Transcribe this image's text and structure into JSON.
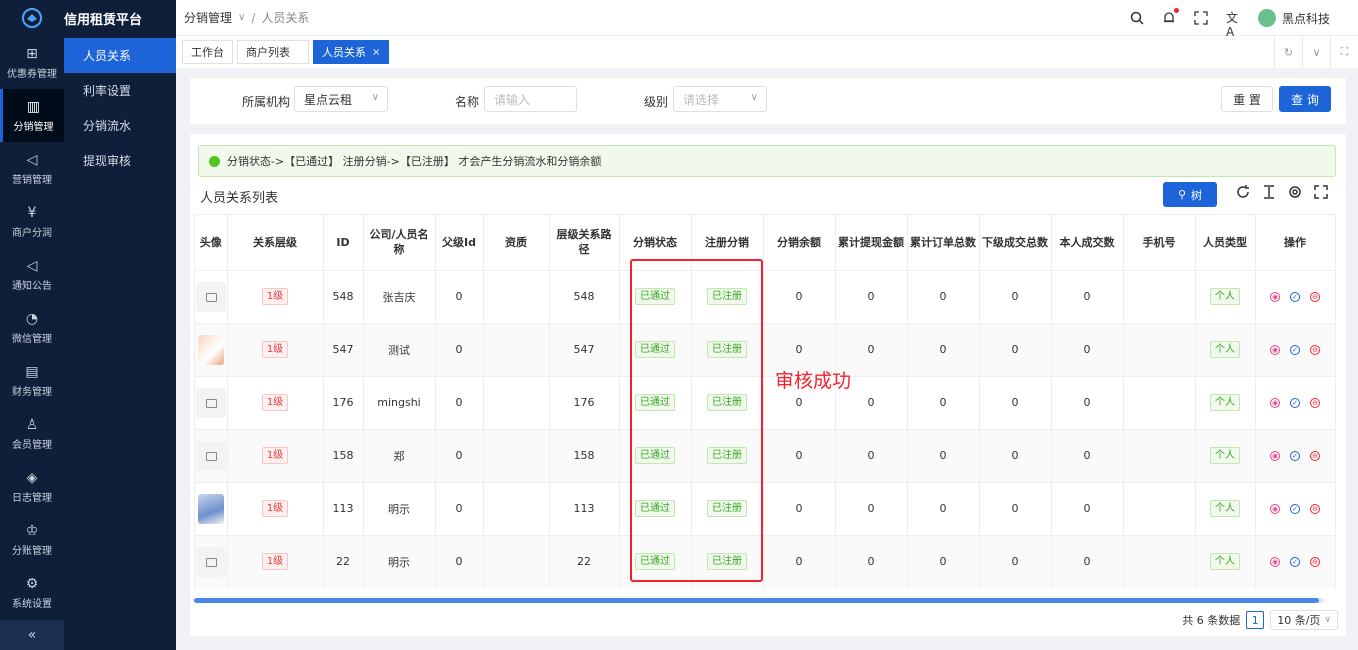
{
  "app": {
    "title": "信用租赁平台"
  },
  "rail": {
    "items": [
      {
        "label": "优惠券管理",
        "icon": "gift-icon"
      },
      {
        "label": "分销管理",
        "icon": "chart-icon",
        "active": true
      },
      {
        "label": "营销管理",
        "icon": "megaphone-icon"
      },
      {
        "label": "商户分润",
        "icon": "yen-icon"
      },
      {
        "label": "通知公告",
        "icon": "notice-icon"
      },
      {
        "label": "微信管理",
        "icon": "wechat-icon"
      },
      {
        "label": "财务管理",
        "icon": "finance-icon"
      },
      {
        "label": "会员管理",
        "icon": "member-icon"
      },
      {
        "label": "日志管理",
        "icon": "shield-icon"
      },
      {
        "label": "分账管理",
        "icon": "split-icon"
      },
      {
        "label": "系统设置",
        "icon": "gear-icon"
      }
    ],
    "collapse": "«"
  },
  "submenu": {
    "items": [
      "人员关系",
      "利率设置",
      "分销流水",
      "提现审核"
    ]
  },
  "header": {
    "breadcrumb": [
      "分销管理",
      "人员关系"
    ],
    "user": "黑点科技"
  },
  "tabs": [
    {
      "label": "工作台"
    },
    {
      "label": "商户列表"
    },
    {
      "label": "人员关系",
      "active": true
    }
  ],
  "filter": {
    "org_label": "所属机构",
    "org_value": "星点云租",
    "name_label": "名称",
    "name_placeholder": "请输入",
    "level_label": "级别",
    "level_placeholder": "请选择",
    "reset": "重 置",
    "query": "查 询"
  },
  "card": {
    "alert": "分销状态->【已通过】 注册分销->【已注册】 才会产生分销流水和分销余额",
    "title": "人员关系列表",
    "tree_button": "树"
  },
  "table": {
    "headers": [
      "头像",
      "关系层级",
      "ID",
      "公司/人员名称",
      "父级Id",
      "资质",
      "层级关系路径",
      "分销状态",
      "注册分销",
      "分销余额",
      "累计提现金额",
      "累计订单总数",
      "下级成交总数",
      "本人成交数",
      "手机号",
      "人员类型",
      "操作"
    ],
    "rows": [
      {
        "avatar": "placeholder",
        "level": "1级",
        "id": "548",
        "name": "张吉庆",
        "parent": "0",
        "path": "548",
        "status": "已通过",
        "reg": "已注册",
        "balance": "0",
        "withdraw": "0",
        "orders": "0",
        "sub_deals": "0",
        "own_deals": "0",
        "phone": "",
        "type": "个人"
      },
      {
        "avatar": "photo-cartoon",
        "level": "1级",
        "id": "547",
        "name": "测试",
        "parent": "0",
        "path": "547",
        "status": "已通过",
        "reg": "已注册",
        "balance": "0",
        "withdraw": "0",
        "orders": "0",
        "sub_deals": "0",
        "own_deals": "0",
        "phone": "",
        "type": "个人"
      },
      {
        "avatar": "placeholder",
        "level": "1级",
        "id": "176",
        "name": "mingshi",
        "parent": "0",
        "path": "176",
        "status": "已通过",
        "reg": "已注册",
        "balance": "0",
        "withdraw": "0",
        "orders": "0",
        "sub_deals": "0",
        "own_deals": "0",
        "phone": "",
        "type": "个人"
      },
      {
        "avatar": "placeholder",
        "level": "1级",
        "id": "158",
        "name": "郑",
        "parent": "0",
        "path": "158",
        "status": "已通过",
        "reg": "已注册",
        "balance": "0",
        "withdraw": "0",
        "orders": "0",
        "sub_deals": "0",
        "own_deals": "0",
        "phone": "",
        "type": "个人"
      },
      {
        "avatar": "photo-blue",
        "level": "1级",
        "id": "113",
        "name": "明示",
        "parent": "0",
        "path": "113",
        "status": "已通过",
        "reg": "已注册",
        "balance": "0",
        "withdraw": "0",
        "orders": "0",
        "sub_deals": "0",
        "own_deals": "0",
        "phone": "",
        "type": "个人"
      },
      {
        "avatar": "placeholder",
        "level": "1级",
        "id": "22",
        "name": "明示",
        "parent": "0",
        "path": "22",
        "status": "已通过",
        "reg": "已注册",
        "balance": "0",
        "withdraw": "0",
        "orders": "0",
        "sub_deals": "0",
        "own_deals": "0",
        "phone": "",
        "type": "个人"
      }
    ]
  },
  "pager": {
    "total": "共 6 条数据",
    "page": "1",
    "page_size": "10 条/页"
  },
  "annotation": "审核成功",
  "colors": {
    "primary": "#1c64d8",
    "sidebar": "#0f1f3a",
    "highlight": "#f5222d"
  }
}
